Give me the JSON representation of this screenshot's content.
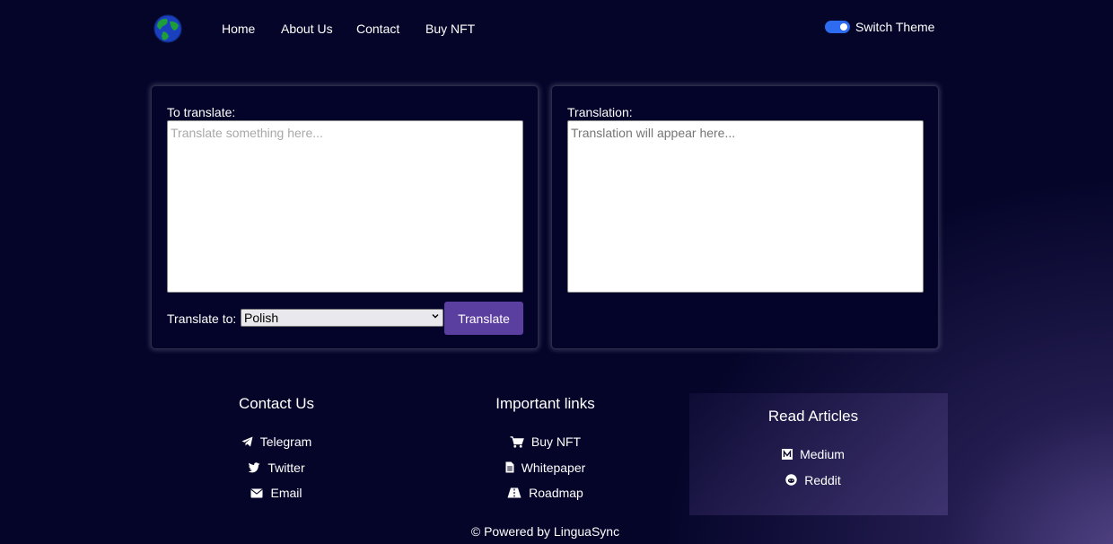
{
  "nav": {
    "links": [
      "Home",
      "About Us",
      "Contact",
      "Buy NFT"
    ],
    "theme_label": "Switch Theme",
    "theme_on": true
  },
  "translate_panel": {
    "input_label": "To translate:",
    "input_placeholder": "Translate something here...",
    "target_label": "Translate to:",
    "selected_language": "Polish",
    "button_label": "Translate"
  },
  "output_panel": {
    "label": "Translation:",
    "placeholder": "Translation will appear here..."
  },
  "footer": {
    "contact": {
      "title": "Contact Us",
      "links": [
        {
          "label": "Telegram",
          "icon": "telegram-icon"
        },
        {
          "label": "Twitter",
          "icon": "twitter-icon"
        },
        {
          "label": "Email",
          "icon": "email-icon"
        }
      ]
    },
    "important": {
      "title": "Important links",
      "links": [
        {
          "label": "Buy NFT",
          "icon": "cart-icon"
        },
        {
          "label": "Whitepaper",
          "icon": "document-icon"
        },
        {
          "label": "Roadmap",
          "icon": "road-icon"
        }
      ]
    },
    "articles": {
      "title": "Read Articles",
      "links": [
        {
          "label": "Medium",
          "icon": "medium-icon"
        },
        {
          "label": "Reddit",
          "icon": "reddit-icon"
        }
      ]
    },
    "copyright": "© Powered by LinguaSync"
  },
  "colors": {
    "background": "#05052a",
    "accent_button": "#5b3fa0",
    "toggle": "#2d6cf0"
  }
}
